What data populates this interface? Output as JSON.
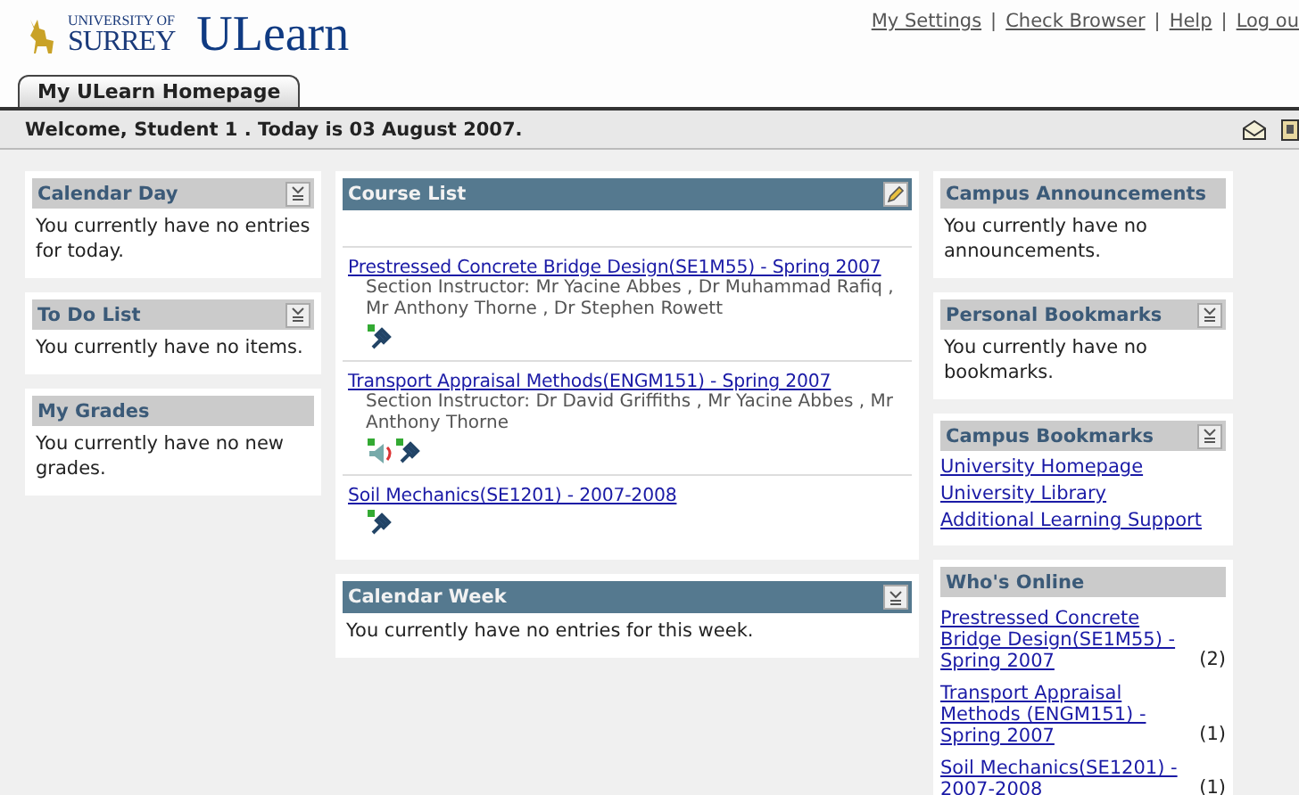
{
  "header": {
    "logo_line1": "UNIVERSITY OF",
    "logo_line2": "SURREY",
    "app_name": "ULearn",
    "links": [
      "My Settings",
      "Check Browser",
      "Help",
      "Log ou"
    ],
    "separator": "|"
  },
  "tabs": [
    {
      "label": "My ULearn Homepage",
      "selected": true
    }
  ],
  "welcome": "Welcome, Student 1 . Today is 03 August 2007.",
  "columns": [
    {
      "modules": [
        {
          "title": "Calendar Day",
          "collapsible": true,
          "kind": "text",
          "text": "You currently have no entries for today."
        },
        {
          "title": "To Do List",
          "collapsible": true,
          "kind": "text",
          "text": "You currently have no items."
        },
        {
          "title": "My Grades",
          "kind": "text",
          "text": "You currently have no new grades."
        }
      ]
    },
    {
      "modules": [
        {
          "title": "Course List",
          "editable": true,
          "kind": "courses",
          "courses": [
            {
              "title": "Prestressed Concrete Bridge Design(SE1M55) - Spring 2007",
              "instructors": "Section Instructor: Mr Yacine Abbes , Dr Muhammad Rafiq , Mr Anthony Thorne , Dr Stephen Rowett",
              "tools": [
                {
                  "kind": "pin"
                }
              ]
            },
            {
              "title": "Transport Appraisal Methods(ENGM151) - Spring 2007",
              "instructors": "Section Instructor: Dr David Griffiths , Mr Yacine Abbes , Mr Anthony Thorne",
              "tools": [
                {
                  "kind": "speaker"
                },
                {
                  "kind": "pin"
                }
              ]
            },
            {
              "title": "Soil Mechanics(SE1201) - 2007-2008",
              "tools": [
                {
                  "kind": "pin"
                }
              ]
            }
          ]
        },
        {
          "title": "Calendar Week",
          "collapsible": true,
          "kind": "text",
          "text": "You currently have no entries for this week."
        }
      ]
    },
    {
      "modules": [
        {
          "title": "Campus Announcements",
          "kind": "text",
          "text": "You currently have no announcements."
        },
        {
          "title": "Personal Bookmarks",
          "collapsible": true,
          "kind": "text",
          "text": "You currently have no bookmarks."
        },
        {
          "title": "Campus Bookmarks",
          "collapsible": true,
          "kind": "links",
          "links": [
            "University Homepage",
            "University Library",
            "Additional Learning Support"
          ]
        },
        {
          "title": "Who's Online",
          "kind": "online",
          "online": [
            {
              "title": "Prestressed Concrete Bridge Design(SE1M55) - Spring 2007",
              "count": "(2)"
            },
            {
              "title": "Transport Appraisal Methods (ENGM151) - Spring 2007",
              "count": "(1)"
            },
            {
              "title": "Soil Mechanics(SE1201) - 2007-2008",
              "count": "(1)"
            }
          ]
        }
      ]
    }
  ]
}
